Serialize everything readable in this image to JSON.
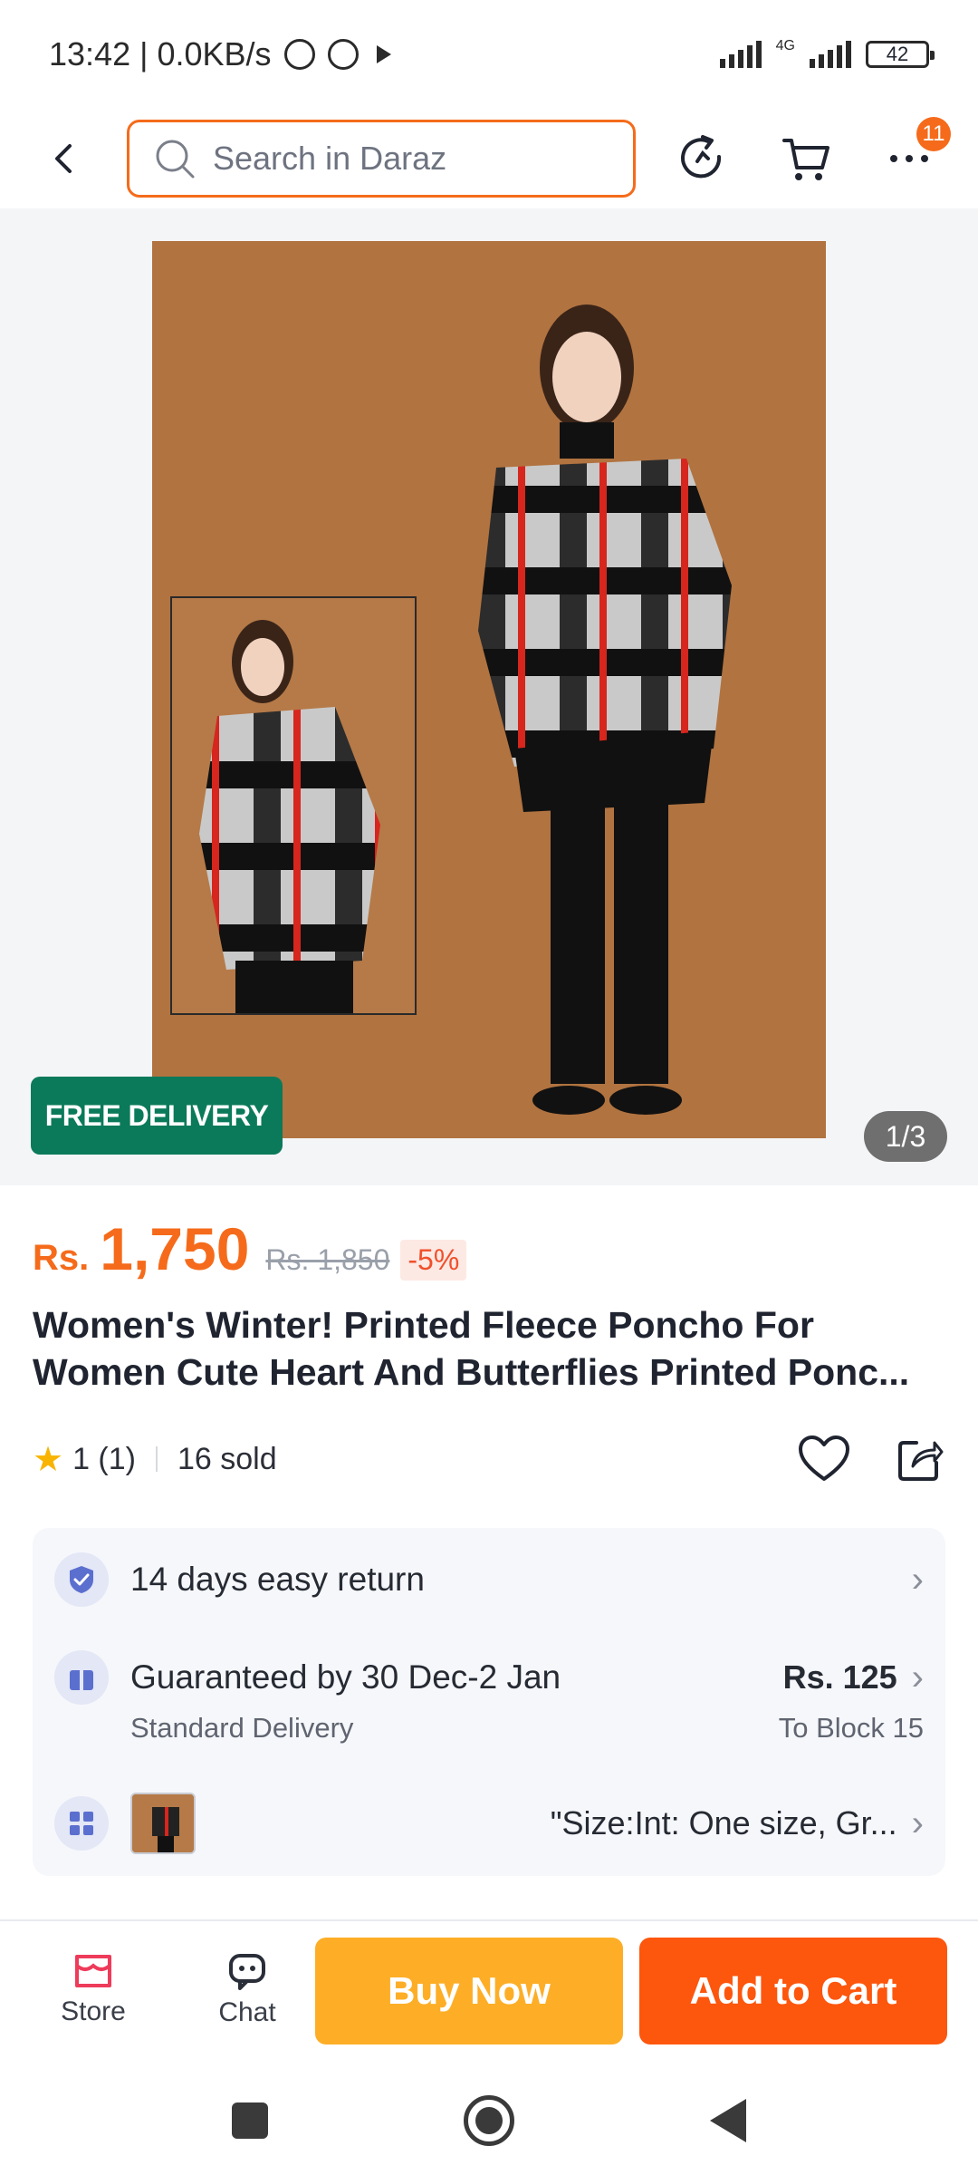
{
  "status_bar": {
    "time_speed": "13:42 | 0.0KB/s",
    "network": "4G",
    "battery": "42"
  },
  "search": {
    "placeholder": "Search in Daraz",
    "cart_badge": "11"
  },
  "gallery": {
    "badge": "FREE DELIVERY",
    "pager": "1/3"
  },
  "product": {
    "currency": "Rs.",
    "price": "1,750",
    "old_price": "Rs. 1,850",
    "discount": "-5%",
    "title_line1": "Women's Winter! Printed Fleece Poncho For",
    "title_line2": "Women Cute Heart And Butterflies Printed Ponc...",
    "rating": "1 (1)",
    "sold": "16 sold"
  },
  "info": {
    "return": "14 days easy return",
    "delivery_title": "Guaranteed by 30 Dec-2 Jan",
    "delivery_sub": "Standard Delivery",
    "delivery_price": "Rs. 125",
    "delivery_to": "To Block 15",
    "variant": "\"Size:Int: One size, Gr..."
  },
  "bottom": {
    "store": "Store",
    "chat": "Chat",
    "buy_now": "Buy Now",
    "add_to_cart": "Add to Cart"
  },
  "colors": {
    "accent": "#f56b1b",
    "buy_now": "#fdae26",
    "add_to_cart": "#fd560d",
    "free_delivery": "#0b7a5a"
  }
}
